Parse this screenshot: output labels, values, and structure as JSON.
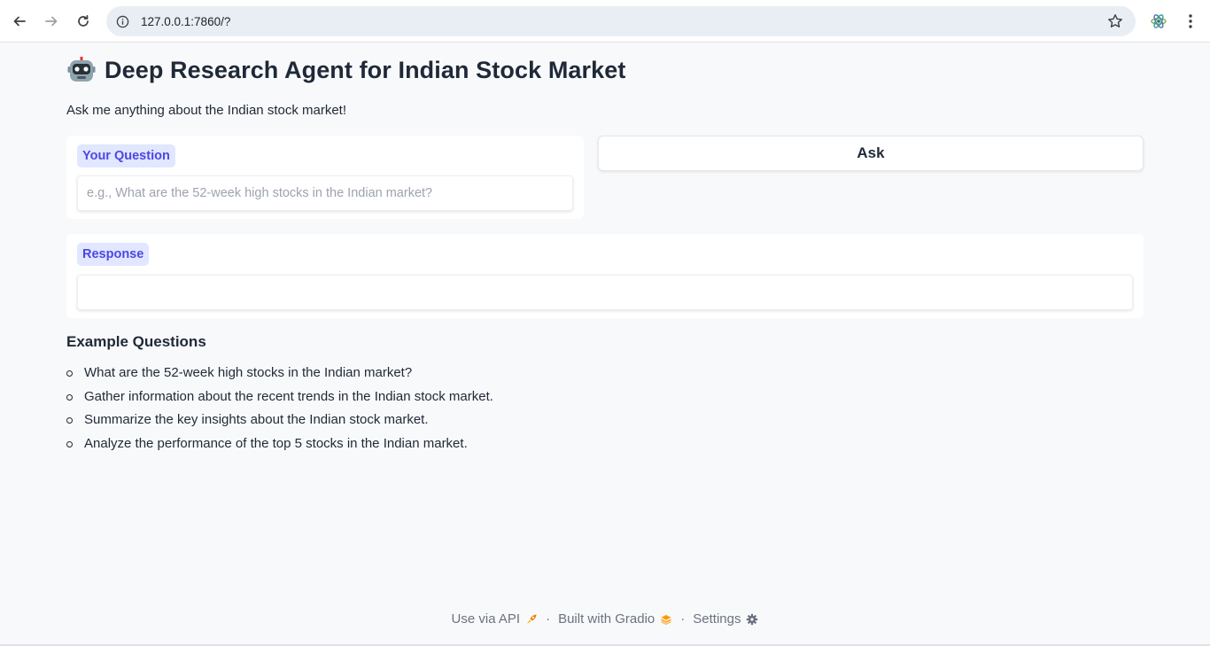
{
  "browser": {
    "url": "127.0.0.1:7860/?"
  },
  "app": {
    "title": "Deep Research Agent for Indian Stock Market",
    "subtitle": "Ask me anything about the Indian stock market!",
    "question_label": "Your Question",
    "question_placeholder": "e.g., What are the 52-week high stocks in the Indian market?",
    "question_value": "",
    "ask_label": "Ask",
    "response_label": "Response",
    "response_value": "",
    "examples_title": "Example Questions",
    "examples": [
      "What are the 52-week high stocks in the Indian market?",
      "Gather information about the recent trends in the Indian stock market.",
      "Summarize the key insights about the Indian stock market.",
      "Analyze the performance of the top 5 stocks in the Indian market."
    ]
  },
  "footer": {
    "api": "Use via API",
    "dot": "·",
    "built": "Built with Gradio",
    "settings": "Settings"
  },
  "colors": {
    "accent": "#4f46e5",
    "chip_bg": "#e0e7ff",
    "page_bg": "#f8f9fb"
  }
}
